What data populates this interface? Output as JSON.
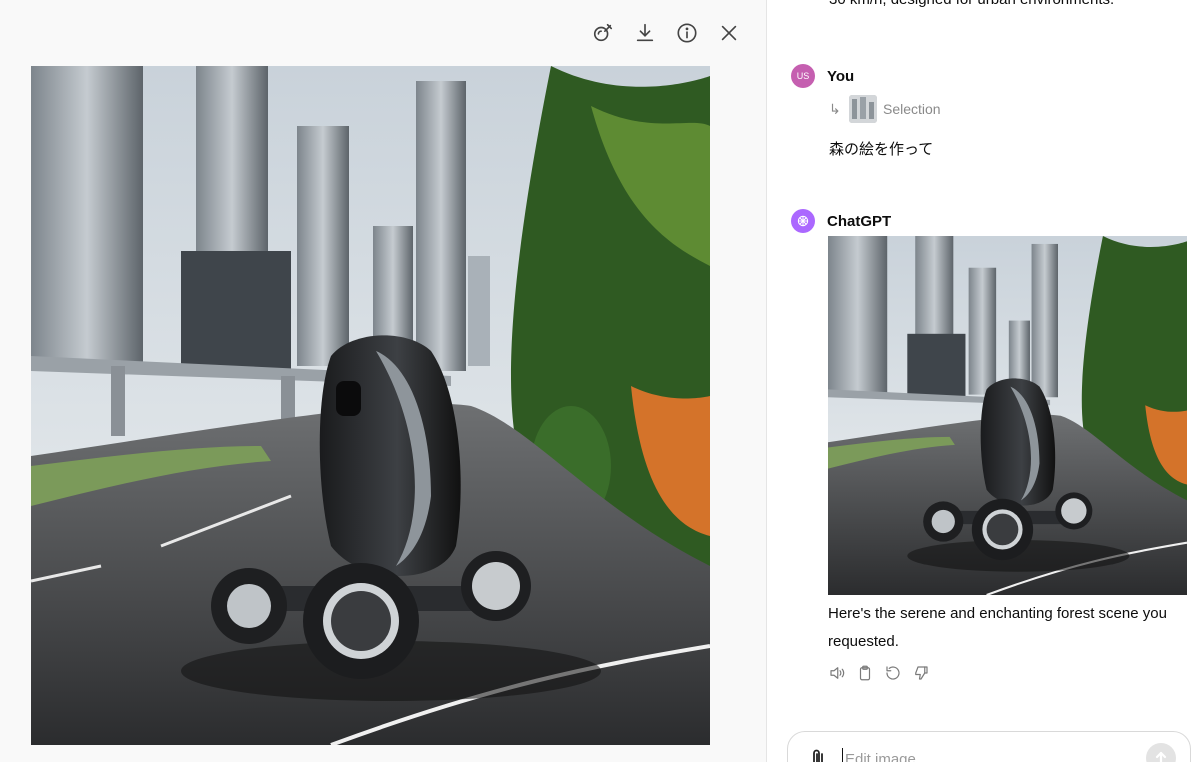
{
  "viewer": {
    "toolbar": [
      {
        "name": "edit-selection-icon"
      },
      {
        "name": "download-icon"
      },
      {
        "name": "info-icon"
      },
      {
        "name": "close-icon"
      }
    ],
    "image_description_icon": "generated-image"
  },
  "chat": {
    "previous_text": "30 km/h, designed for urban environments.",
    "user_message": {
      "avatar_initials": "US",
      "name": "You",
      "selection_label": "Selection",
      "text": "森の絵を作って"
    },
    "assistant_message": {
      "name": "ChatGPT",
      "text": "Here's the serene and enchanting forest scene you requested."
    },
    "actions": [
      "speaker-icon",
      "clipboard-icon",
      "regenerate-icon",
      "thumbs-down-icon"
    ],
    "composer": {
      "placeholder": "Edit image"
    }
  },
  "colors": {
    "user_avatar": "#c55fb0",
    "assistant_avatar": "#ab68ff",
    "viewer_bg": "#f9f9f9"
  }
}
